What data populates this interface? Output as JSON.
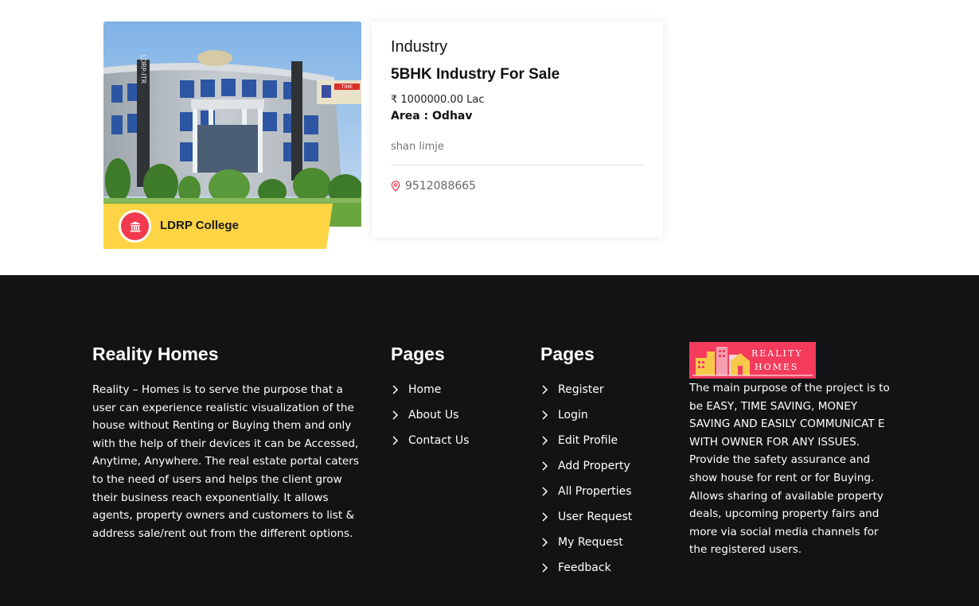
{
  "listing": {
    "college_name": "LDRP College",
    "category": "Industry",
    "title": "5BHK Industry For Sale",
    "price": "₹ 1000000.00 Lac",
    "area": "Area : Odhav",
    "owner": "shan limje",
    "phone": "9512088665",
    "photo_sign_vertical": "LDRP-ITR",
    "photo_sign_board": "TIME"
  },
  "footer": {
    "about": {
      "heading": "Reality Homes",
      "text": "Reality – Homes is to serve the purpose that a user can experience realistic visualization of the house without Renting or Buying them and only with the help of their devices it can be Accessed, Anytime, Anywhere. The real estate portal caters to the need of users and helps the client grow their business reach exponentially. It allows agents, property owners and customers to list & address sale/rent out from the different options."
    },
    "pages1": {
      "heading": "Pages",
      "links": [
        "Home",
        "About Us",
        "Contact Us"
      ]
    },
    "pages2": {
      "heading": "Pages",
      "links": [
        "Register",
        "Login",
        "Edit Profile",
        "Add Property",
        "All Properties",
        "User Request",
        "My Request",
        "Feedback"
      ]
    },
    "brand": {
      "logo_line1": "REALITY",
      "logo_line2": "HOMES",
      "text": "The main purpose of the project is to be EASY, TIME SAVING, MONEY SAVING AND EASILY COMMUNICAT E WITH OWNER FOR ANY ISSUES. Provide the safety assurance and show house for rent or for Buying. Allows sharing of available property deals, upcoming property fairs and more via social media channels for the registered users."
    }
  },
  "colors": {
    "accent_red": "#f23a4e",
    "tag_yellow": "#fdd444",
    "footer_bg": "#121315",
    "logo_bg": "#f43b5c"
  }
}
